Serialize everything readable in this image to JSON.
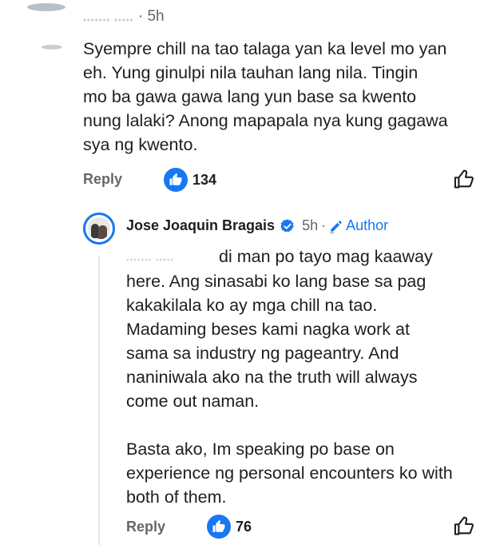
{
  "comment": {
    "author": "....... .....",
    "time": "5h",
    "text_lines": [
      "Syempre chill na tao talaga yan ka level mo yan",
      "eh. Yung ginulpi nila tauhan lang nila. Tingin",
      "mo ba gawa gawa lang yun base sa kwento",
      "nung lalaki? Anong mapapala nya kung gagawa",
      "sya ng kwento."
    ],
    "reply_label": "Reply",
    "like_count": "134"
  },
  "reply": {
    "author": "Jose Joaquin Bragais",
    "time": "5h",
    "separator": "·",
    "author_badge": "Author",
    "mention": "....... .....",
    "paragraph1": [
      "di man po tayo mag kaaway",
      "here. Ang sinasabi ko lang base sa pag",
      "kakakilala ko ay mga chill na tao.",
      "Madaming beses kami nagka work at",
      "sama sa industry ng pageantry. And",
      "naniniwala ako na the truth will always",
      "come out naman."
    ],
    "paragraph2": [
      "Basta ako, Im speaking po base on",
      "experience ng personal encounters ko with",
      "both of them."
    ],
    "reply_label": "Reply",
    "like_count": "76"
  },
  "colors": {
    "accent": "#1877f2",
    "secondary_text": "#65676b",
    "primary_text": "#1c1e21"
  },
  "icons": {
    "like_badge": "thumbs-up-filled-icon",
    "like_button": "thumbs-up-outline-icon",
    "verified": "verified-badge-icon",
    "author": "pencil-icon"
  }
}
